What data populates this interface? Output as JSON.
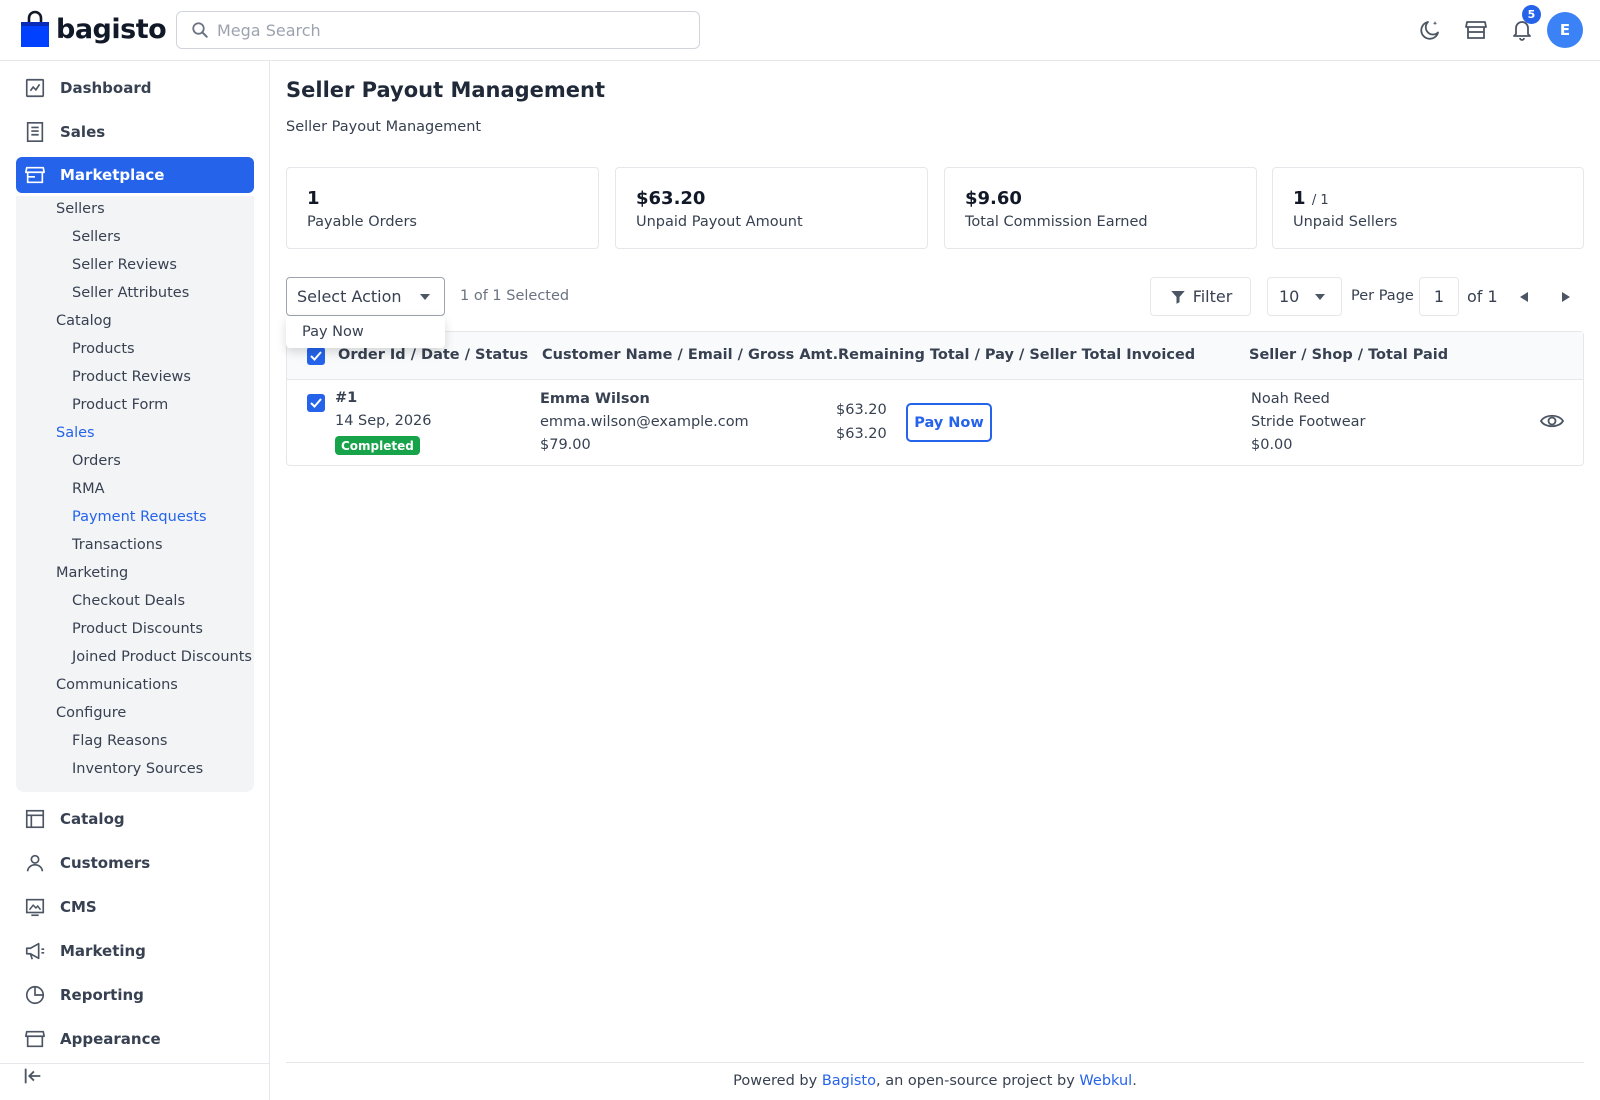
{
  "header": {
    "logo_text": "bagisto",
    "search_placeholder": "Mega Search",
    "notification_count": "5",
    "avatar_letter": "E"
  },
  "sidebar": {
    "top_items": [
      {
        "label": "Dashboard",
        "icon": "dashboard-icon"
      },
      {
        "label": "Sales",
        "icon": "receipt-icon"
      },
      {
        "label": "Marketplace",
        "icon": "store-icon"
      }
    ],
    "marketplace_children": [
      {
        "label": "Sellers",
        "level": 1
      },
      {
        "label": "Sellers",
        "level": 2
      },
      {
        "label": "Seller Reviews",
        "level": 2
      },
      {
        "label": "Seller Attributes",
        "level": 2
      },
      {
        "label": "Catalog",
        "level": 1
      },
      {
        "label": "Products",
        "level": 2
      },
      {
        "label": "Product Reviews",
        "level": 2
      },
      {
        "label": "Product Form",
        "level": 2
      },
      {
        "label": "Sales",
        "level": 1
      },
      {
        "label": "Orders",
        "level": 2
      },
      {
        "label": "RMA",
        "level": 2
      },
      {
        "label": "Payment Requests",
        "level": 2
      },
      {
        "label": "Transactions",
        "level": 2
      },
      {
        "label": "Marketing",
        "level": 1
      },
      {
        "label": "Checkout Deals",
        "level": 2
      },
      {
        "label": "Product Discounts",
        "level": 2
      },
      {
        "label": "Joined Product Discounts",
        "level": 2
      },
      {
        "label": "Communications",
        "level": 1
      },
      {
        "label": "Configure",
        "level": 1
      },
      {
        "label": "Flag Reasons",
        "level": 2
      },
      {
        "label": "Inventory Sources",
        "level": 2
      }
    ],
    "bottom_items": [
      {
        "label": "Catalog",
        "icon": "catalog-icon"
      },
      {
        "label": "Customers",
        "icon": "user-icon"
      },
      {
        "label": "CMS",
        "icon": "cms-icon"
      },
      {
        "label": "Marketing",
        "icon": "megaphone-icon"
      },
      {
        "label": "Reporting",
        "icon": "pie-chart-icon"
      },
      {
        "label": "Appearance",
        "icon": "appearance-icon"
      }
    ]
  },
  "page": {
    "title": "Seller Payout Management",
    "subtitle": "Seller Payout Management"
  },
  "stats": [
    {
      "value": "1",
      "extra": "",
      "label": "Payable Orders"
    },
    {
      "value": "$63.20",
      "extra": "",
      "label": "Unpaid Payout Amount"
    },
    {
      "value": "$9.60",
      "extra": "",
      "label": "Total Commission Earned"
    },
    {
      "value": "1",
      "extra": "/ 1",
      "label": "Unpaid Sellers"
    }
  ],
  "toolbar": {
    "select_action": "Select Action",
    "selected_count": "1 of 1 Selected",
    "dropdown_option": "Pay Now",
    "filter_label": "Filter",
    "per_page_value": "10",
    "per_page_label": "Per Page",
    "current_page": "1",
    "of_pages": "of 1"
  },
  "table": {
    "headers": [
      "Order Id / Date / Status",
      "Customer Name / Email / Gross Amt.",
      "Remaining Total / Pay / Seller Total Invoiced",
      "Seller / Shop / Total Paid"
    ],
    "rows": [
      {
        "order_id": "#1",
        "date": "14 Sep, 2026",
        "status": "Completed",
        "customer_name": "Emma Wilson",
        "customer_email": "emma.wilson@example.com",
        "gross_amount": "$79.00",
        "remaining_total": "$63.20",
        "seller_total_invoiced": "$63.20",
        "pay_label": "Pay Now",
        "seller_name": "Noah Reed",
        "shop": "Stride Footwear",
        "total_paid": "$0.00"
      }
    ]
  },
  "footer": {
    "prefix": "Powered by ",
    "link1": "Bagisto",
    "middle": ", an open-source project by ",
    "link2": "Webkul",
    "suffix": "."
  },
  "colors": {
    "primary": "#2563eb",
    "success": "#16a34a"
  }
}
